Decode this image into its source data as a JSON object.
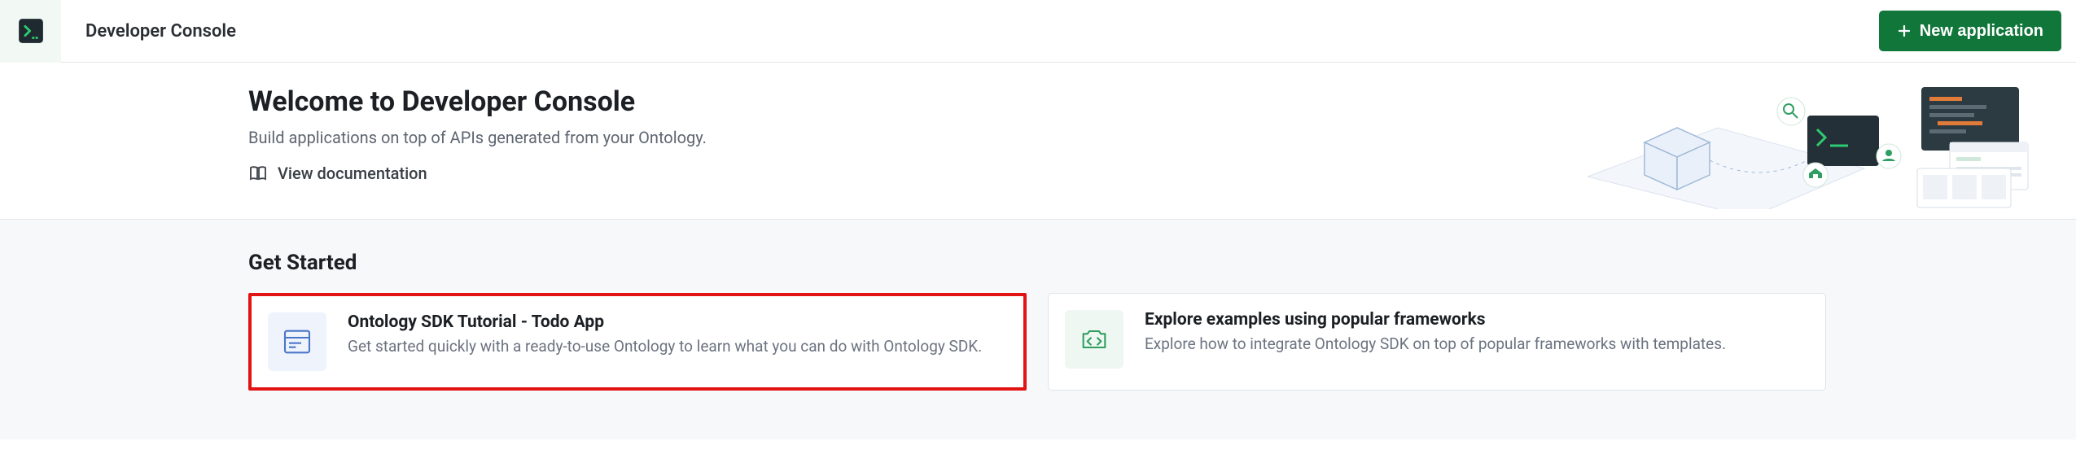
{
  "header": {
    "app_title": "Developer Console",
    "new_app_label": "New application"
  },
  "welcome": {
    "heading": "Welcome to Developer Console",
    "subheading": "Build applications on top of APIs generated from your Ontology.",
    "doc_link_label": "View documentation"
  },
  "getstarted": {
    "heading": "Get Started",
    "cards": [
      {
        "title": "Ontology SDK Tutorial - Todo App",
        "description": "Get started quickly with a ready-to-use Ontology to learn what you can do with Ontology SDK."
      },
      {
        "title": "Explore examples using popular frameworks",
        "description": "Explore how to integrate Ontology SDK on top of popular frameworks with templates."
      }
    ]
  }
}
